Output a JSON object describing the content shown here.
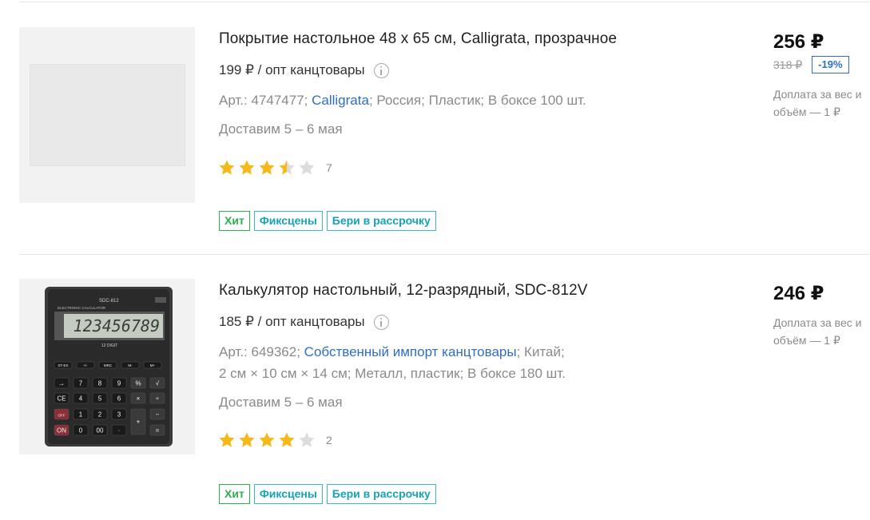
{
  "products": [
    {
      "title": "Покрытие настольное 48 х 65 см, Calligrata, прозрачное",
      "wholesale": "199 ₽ / опт канцтовары",
      "meta_prefix": "Арт.: 4747477; ",
      "brand": "Calligrata",
      "meta_suffix": "; Россия; Пластик; В боксе 100 шт.",
      "delivery": "Доставим 5 – 6 мая",
      "rating": 3.5,
      "review_count": "7",
      "badges": [
        "Хит",
        "Фиксцены",
        "Бери в рассрочку"
      ],
      "price": "256 ₽",
      "old_price": "318 ₽",
      "discount": "-19%",
      "surcharge": "Доплата за вес и объём — 1 ₽",
      "image_icon": "desk-mat-image"
    },
    {
      "title": "Калькулятор настольный, 12-разрядный, SDC-812V",
      "wholesale": "185 ₽ / опт канцтовары",
      "meta_prefix": "Арт.: 649362; ",
      "brand": "Собственный импорт канцтовары",
      "meta_suffix": "; Китай;",
      "meta_line2": "2 см × 10 см × 14 см; Металл, пластик; В боксе 180 шт.",
      "delivery": "Доставим 5 – 6 мая",
      "rating": 4,
      "review_count": "2",
      "badges": [
        "Хит",
        "Фиксцены",
        "Бери в рассрочку"
      ],
      "price": "246 ₽",
      "surcharge": "Доплата за вес и объём — 1 ₽",
      "image_icon": "calculator-image",
      "calc_model": "SDC-812",
      "calc_brand_text": "ELECTRONIC CALCULATOR",
      "calc_display": "123456789",
      "calc_digit_label": "12 DIGIT"
    }
  ],
  "colors": {
    "star_full": "#f5b91a",
    "star_empty": "#dcdcdc",
    "hit": "#2eae4e",
    "teal": "#17a2b8",
    "link": "#2f6fbf"
  }
}
